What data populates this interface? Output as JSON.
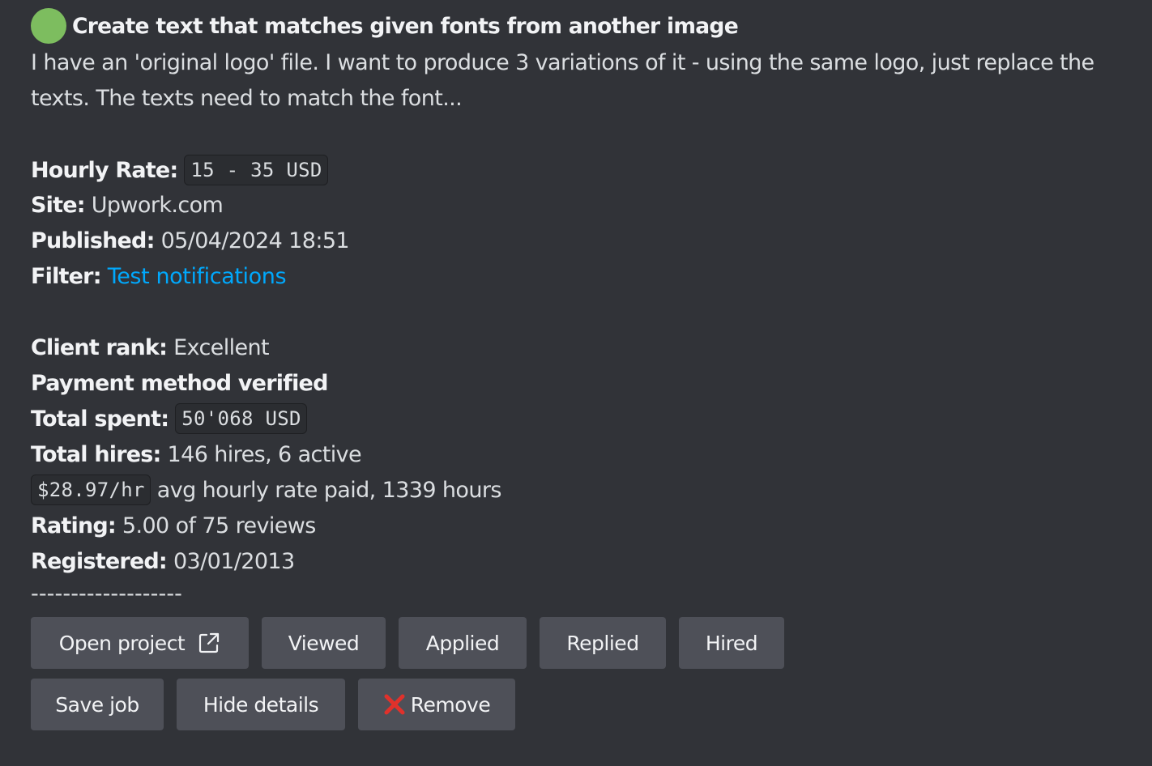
{
  "post": {
    "title": "Create text that matches given fonts from another image",
    "description": "I have an 'original logo' file. I want to produce 3 variations of it - using the same logo, just replace the texts. The texts need to match the font...",
    "hourly_rate_label": "Hourly Rate:",
    "hourly_rate_value": "15 - 35 USD",
    "site_label": "Site:",
    "site_value": "Upwork.com",
    "published_label": "Published:",
    "published_value": "05/04/2024 18:51",
    "filter_label": "Filter:",
    "filter_value": "Test notifications",
    "client_rank_label": "Client rank:",
    "client_rank_value": "Excellent",
    "payment_verified": "Payment method verified",
    "total_spent_label": "Total spent:",
    "total_spent_value": "50'068 USD",
    "total_hires_label": "Total hires:",
    "total_hires_value": "146 hires, 6 active",
    "avg_rate_value": "$28.97/hr",
    "avg_rate_text": "avg hourly rate paid, 1339 hours",
    "rating_label": "Rating:",
    "rating_value": "5.00 of 75 reviews",
    "registered_label": "Registered:",
    "registered_value": "03/01/2013",
    "separator": "-------------------"
  },
  "buttons": {
    "open_project": "Open project",
    "viewed": "Viewed",
    "applied": "Applied",
    "replied": "Replied",
    "hired": "Hired",
    "save_job": "Save job",
    "hide_details": "Hide details",
    "remove": "Remove"
  },
  "icons": {
    "status_dot": "green-circle-icon",
    "open_project": "external-link-icon",
    "remove": "red-x-icon"
  },
  "colors": {
    "background": "#313338",
    "button": "#4e5058",
    "link": "#00a8fc",
    "status_dot": "#7dbd5f",
    "remove_x": "#e0312b"
  }
}
